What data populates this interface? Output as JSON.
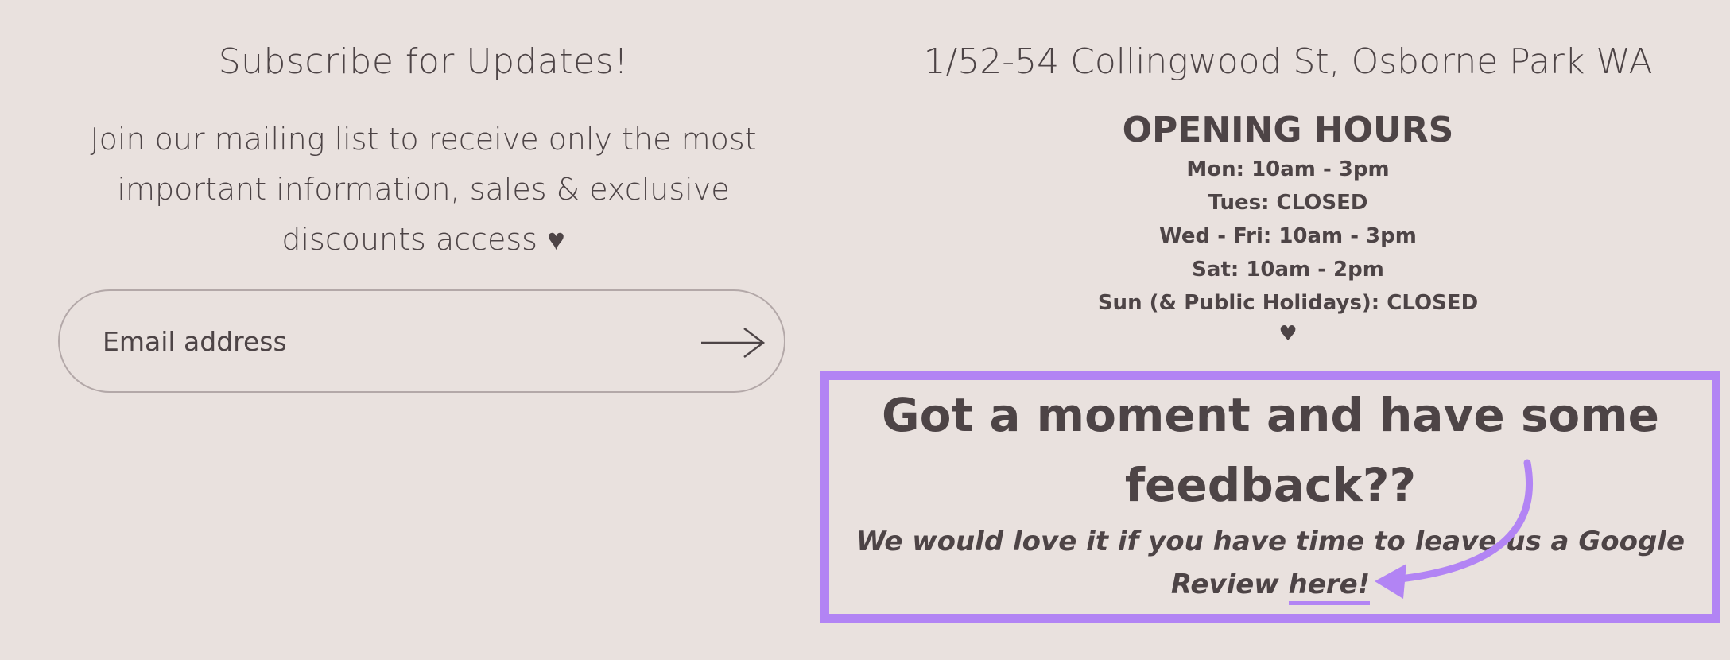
{
  "subscribe": {
    "title": "Subscribe for Updates!",
    "body": "Join our mailing list to receive only the most important information, sales & exclusive discounts access",
    "heart_icon": "♥",
    "email_placeholder": "Email address",
    "submit_icon": "arrow-right-icon"
  },
  "info": {
    "address": "1/52-54 Collingwood St, Osborne Park WA",
    "hours_title": "OPENING HOURS",
    "hours": [
      "Mon: 10am - 3pm",
      "Tues: CLOSED",
      "Wed - Fri: 10am - 3pm",
      "Sat: 10am - 2pm",
      "Sun (& Public Holidays): CLOSED"
    ],
    "heart_icon": "♥"
  },
  "feedback": {
    "title": "Got a moment and have some feedback??",
    "text_before_link": "We would love it if you have time to leave us a Google Review ",
    "link_text": "here!",
    "highlight_color": "#b284f4"
  },
  "colors": {
    "background": "#e9e1de",
    "text": "#4d4446",
    "accent": "#b284f4",
    "field_border": "#b3a8a8"
  }
}
